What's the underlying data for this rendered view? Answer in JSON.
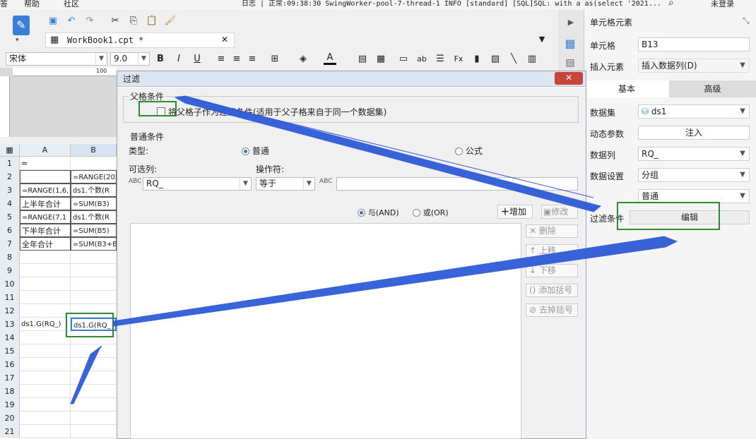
{
  "menu": {
    "item1": "答",
    "help": "帮助",
    "community": "社区",
    "login": "未登录"
  },
  "log_text": "日志 | 正常:09:38:30 SwingWorker-pool-7-thread-1 INFO [standard] [SQL]SQL: with a as(select '2021...",
  "tab": {
    "label": "WorkBook1.cpt *",
    "close": "✕"
  },
  "font": {
    "name": "宋体",
    "size": "9.0"
  },
  "format_buttons": [
    "B",
    "I",
    "U"
  ],
  "ruler": {
    "mark": "100"
  },
  "sheet": {
    "col_headers": [
      "A",
      "B"
    ],
    "rows": [
      {
        "num": "1",
        "a": "=",
        "b": ""
      },
      {
        "num": "2",
        "a": "",
        "b": "=RANGE(202"
      },
      {
        "num": "3",
        "a": "=RANGE(1,6,",
        "b": "ds1.个数(R"
      },
      {
        "num": "4",
        "a": "上半年合计",
        "b": "=SUM(B3)"
      },
      {
        "num": "5",
        "a": "=RANGE(7,1",
        "b": "ds1.个数(R"
      },
      {
        "num": "6",
        "a": "下半年合计",
        "b": "=SUM(B5)"
      },
      {
        "num": "7",
        "a": "全年合计",
        "b": "=SUM(B3+B5"
      },
      {
        "num": "8",
        "a": "",
        "b": ""
      },
      {
        "num": "9",
        "a": "",
        "b": ""
      },
      {
        "num": "10",
        "a": "",
        "b": ""
      },
      {
        "num": "11",
        "a": "",
        "b": ""
      },
      {
        "num": "12",
        "a": "",
        "b": ""
      },
      {
        "num": "13",
        "a": "ds1.G(RQ_)",
        "b": "ds1.G(RQ_"
      },
      {
        "num": "14",
        "a": "",
        "b": ""
      },
      {
        "num": "15",
        "a": "",
        "b": ""
      },
      {
        "num": "16",
        "a": "",
        "b": ""
      },
      {
        "num": "17",
        "a": "",
        "b": ""
      },
      {
        "num": "18",
        "a": "",
        "b": ""
      },
      {
        "num": "19",
        "a": "",
        "b": ""
      },
      {
        "num": "20",
        "a": "",
        "b": ""
      },
      {
        "num": "21",
        "a": "",
        "b": ""
      }
    ]
  },
  "props": {
    "title": "单元格元素",
    "cell_label": "单元格",
    "cell_value": "B13",
    "insert_label": "插入元素",
    "insert_value": "插入数据列(D)",
    "tab_basic": "基本",
    "tab_advanced": "高级",
    "dataset_label": "数据集",
    "dataset_value": "ds1",
    "dyn_param_label": "动态参数",
    "dyn_param_button": "注入",
    "datacol_label": "数据列",
    "datacol_value": "RQ_",
    "dataset_setting_label": "数据设置",
    "dataset_setting_value": "分组",
    "setting_mode_value": "普通",
    "filter_label": "过滤条件",
    "filter_button": "编辑"
  },
  "dialog": {
    "title": "过滤",
    "close": "✕",
    "parent_section": "父格条件",
    "parent_checkbox": "将父格子作为过滤条件(适用于父子格来自于同一个数据集)",
    "normal_section": "普通条件",
    "type_label": "类型:",
    "type_normal": "普通",
    "type_formula": "公式",
    "optional_col_label": "可选列:",
    "operator_label": "操作符:",
    "column_value": "RQ_",
    "operator_value": "等于",
    "and_label": "与(AND)",
    "or_label": "或(OR)",
    "add_button": "增加",
    "modify_button": "修改",
    "delete_button": "删除",
    "up_button": "上移",
    "down_button": "下移",
    "add_paren_button": "添加括号",
    "remove_paren_button": "去掉括号"
  }
}
